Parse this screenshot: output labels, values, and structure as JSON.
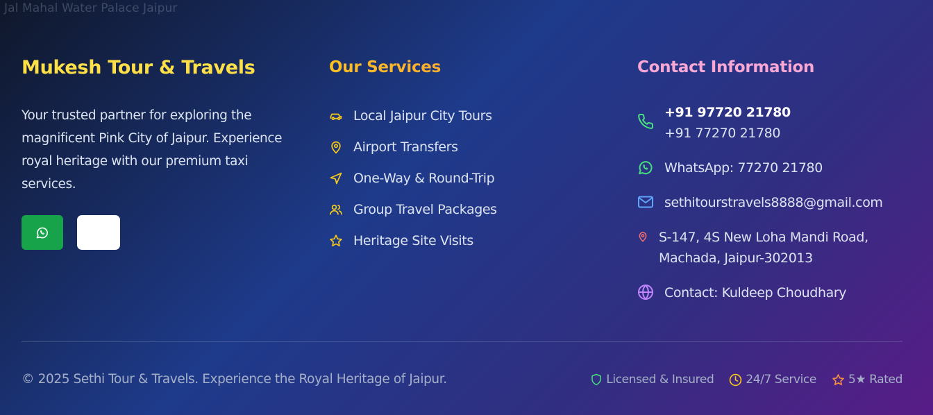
{
  "background": {
    "image_alt": "Jal Mahal Water Palace Jaipur"
  },
  "brand": {
    "name": "Mukesh Tour & Travels",
    "description": "Your trusted partner for exploring the magnificent Pink City of Jaipur. Experience royal heritage with our premium taxi services."
  },
  "social": [
    {
      "icon": "whatsapp-icon",
      "color": "#16a34a"
    },
    {
      "icon": "",
      "color": "#ffffff"
    }
  ],
  "services": {
    "heading": "Our Services",
    "items": [
      {
        "label": "Local Jaipur City Tours",
        "icon": "car-icon"
      },
      {
        "label": "Airport Transfers",
        "icon": "map-pin-icon"
      },
      {
        "label": "One-Way & Round-Trip",
        "icon": "navigation-icon"
      },
      {
        "label": "Group Travel Packages",
        "icon": "users-icon"
      },
      {
        "label": "Heritage Site Visits",
        "icon": "star-icon"
      }
    ]
  },
  "contact": {
    "heading": "Contact Information",
    "phone1": "+91 97720 21780",
    "phone2": "+91 77270 21780",
    "whatsapp": "WhatsApp: 77270 21780",
    "email": "sethitourstravels8888@gmail.com",
    "address_line1": "S-147, 4S New Loha Mandi Road,",
    "address_line2": "Machada, Jaipur-302013",
    "person": "Contact: Kuldeep Choudhary"
  },
  "footer": {
    "copyright": "© 2025 Sethi Tour & Travels. Experience the Royal Heritage of Jaipur.",
    "badges": [
      {
        "label": "Licensed & Insured",
        "icon": "shield-icon",
        "color": "#4ade80"
      },
      {
        "label": "24/7 Service",
        "icon": "clock-icon",
        "color": "#facc15"
      },
      {
        "label": "5★ Rated",
        "icon": "star-icon",
        "color": "#fb923c"
      }
    ]
  },
  "colors": {
    "brand": "#fde047",
    "services_heading": "#fbbf24",
    "contact_heading": "#f9a8d4",
    "service_icon": "#facc15",
    "phone_icon": "#4ade80",
    "whatsapp_icon": "#4ade80",
    "email_icon": "#60a5fa",
    "address_icon": "#f87171",
    "globe_icon": "#c084fc"
  }
}
